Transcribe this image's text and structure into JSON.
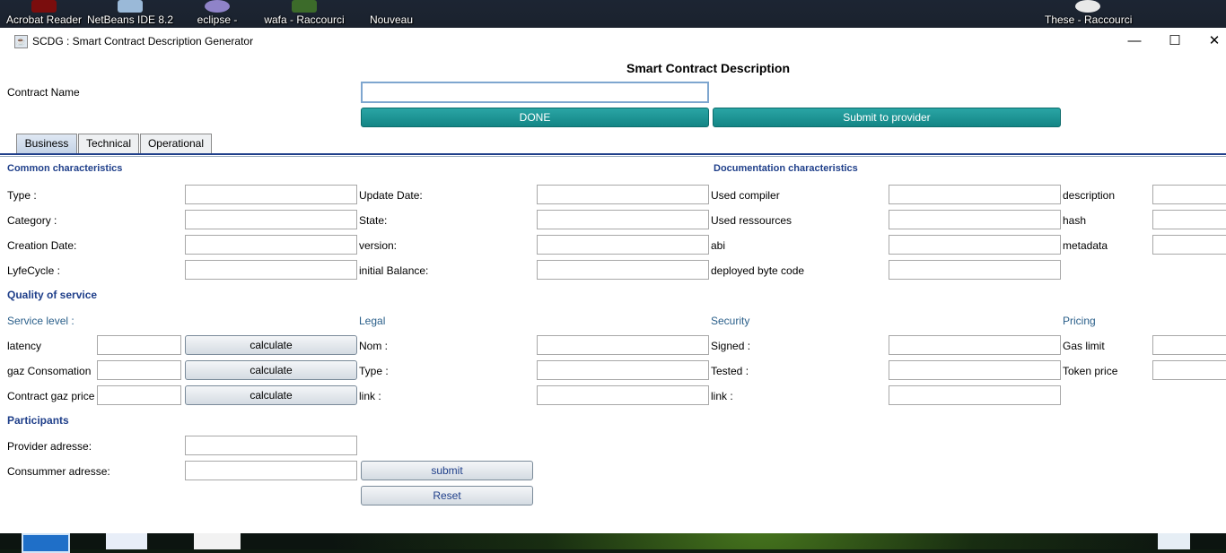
{
  "desktop": {
    "icons": [
      {
        "label": "Acrobat Reader"
      },
      {
        "label": "NetBeans IDE 8.2"
      },
      {
        "label": "eclipse -"
      },
      {
        "label": "wafa - Raccourci"
      },
      {
        "label": "Nouveau"
      },
      {
        "label": "These - Raccourci"
      }
    ]
  },
  "window": {
    "title": "SCDG : Smart Contract Description Generator",
    "controls": {
      "minimize": "—",
      "maximize": "☐",
      "close": "✕"
    }
  },
  "header": {
    "heading": "Smart Contract Description",
    "contract_name_label": "Contract Name",
    "contract_name_value": "",
    "done_label": "DONE",
    "submit_provider_label": "Submit to provider"
  },
  "tabs": [
    {
      "label": "Business"
    },
    {
      "label": "Technical"
    },
    {
      "label": "Operational"
    }
  ],
  "common": {
    "title": "Common characteristics",
    "col1": [
      "Type :",
      "Category :",
      "Creation Date:",
      "LyfeCycle :"
    ],
    "col2": [
      "Update Date:",
      "State:",
      "version:",
      "initial Balance:"
    ]
  },
  "documentation": {
    "title": "Documentation characteristics",
    "col1": [
      "Used compiler",
      "Used ressources",
      "abi",
      "deployed byte code"
    ],
    "col2": [
      "description",
      "hash",
      "metadata"
    ]
  },
  "qos": {
    "title": "Quality of service",
    "service_level": {
      "title": "Service level :",
      "rows": [
        "latency",
        "gaz Consomation",
        "Contract gaz price"
      ],
      "calc_label": "calculate"
    },
    "legal": {
      "title": "Legal",
      "rows": [
        "Nom :",
        "Type :",
        "link :"
      ]
    },
    "security": {
      "title": "Security",
      "rows": [
        "Signed :",
        "Tested :",
        "link :"
      ]
    },
    "pricing": {
      "title": "Pricing",
      "rows": [
        "Gas limit",
        "Token price"
      ]
    }
  },
  "participants": {
    "title": "Participants",
    "provider_label": "Provider adresse:",
    "consumer_label": "Consummer adresse:",
    "submit_label": "submit",
    "reset_label": "Reset"
  },
  "colors": {
    "accent_teal": "#138585",
    "section_blue": "#1f3f8a",
    "subsection_teal": "#2a5f8a"
  }
}
